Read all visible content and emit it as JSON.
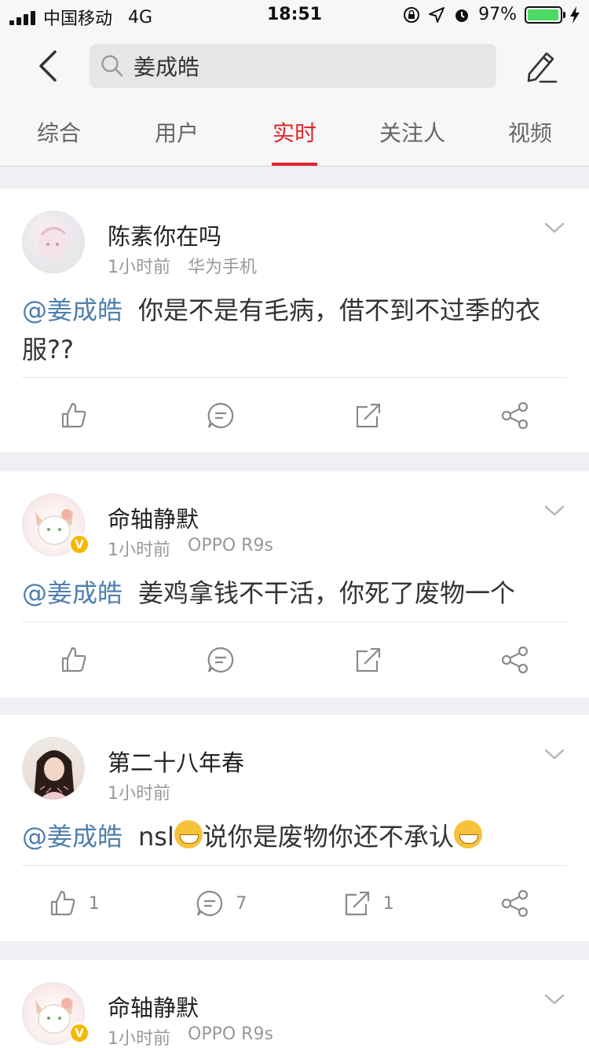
{
  "status_bar": {
    "carrier": "中国移动",
    "network": "4G",
    "time": "18:51",
    "battery_percent": "97%",
    "battery_level": 0.97
  },
  "search": {
    "query": "姜成皓"
  },
  "tabs": [
    {
      "label": "综合",
      "active": false
    },
    {
      "label": "用户",
      "active": false
    },
    {
      "label": "实时",
      "active": true
    },
    {
      "label": "关注人",
      "active": false
    },
    {
      "label": "视频",
      "active": false
    }
  ],
  "posts": [
    {
      "username": "陈素你在吗",
      "time": "1小时前",
      "device": "华为手机",
      "verified": false,
      "mention": "@姜成皓",
      "text": "你是不是有毛病，借不到不过季的衣服??",
      "likes": "",
      "comments": "",
      "reposts": ""
    },
    {
      "username": "命轴静默",
      "time": "1小时前",
      "device": "OPPO R9s",
      "verified": true,
      "verified_badge": "V",
      "mention": "@姜成皓",
      "text": "姜鸡拿钱不干活，你死了废物一个",
      "likes": "",
      "comments": "",
      "reposts": ""
    },
    {
      "username": "第二十八年春",
      "time": "1小时前",
      "device": "",
      "verified": false,
      "mention": "@姜成皓",
      "text_before_emoji": "nsl",
      "text_middle": "说你是废物你还不承认",
      "likes": "1",
      "comments": "7",
      "reposts": "1"
    },
    {
      "username": "命轴静默",
      "time": "1小时前",
      "device": "OPPO R9s",
      "verified": true,
      "verified_badge": "V"
    }
  ],
  "colors": {
    "accent": "#e3262e",
    "mention": "#4f7fae",
    "battery": "#4cd964"
  }
}
